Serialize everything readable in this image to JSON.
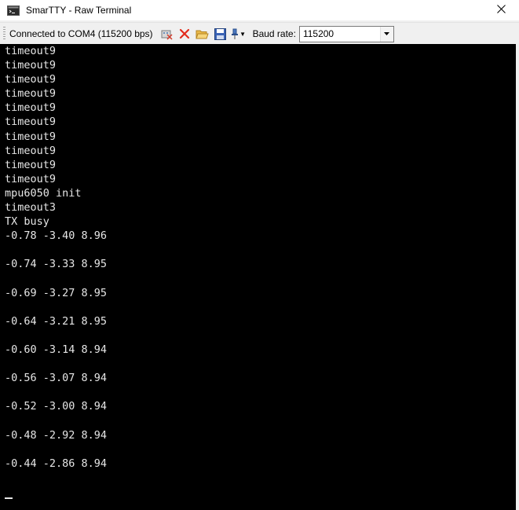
{
  "window": {
    "title": "SmarTTY - Raw Terminal"
  },
  "toolbar": {
    "connection_status": "Connected to COM4 (115200 bps)",
    "baud_label": "Baud rate:",
    "baud_value": "115200"
  },
  "terminal": {
    "lines": [
      "timeout9",
      "timeout9",
      "timeout9",
      "timeout9",
      "timeout9",
      "timeout9",
      "timeout9",
      "timeout9",
      "timeout9",
      "timeout9",
      "mpu6050 init",
      "timeout3",
      "TX busy",
      "-0.78 -3.40 8.96",
      "",
      "-0.74 -3.33 8.95",
      "",
      "-0.69 -3.27 8.95",
      "",
      "-0.64 -3.21 8.95",
      "",
      "-0.60 -3.14 8.94",
      "",
      "-0.56 -3.07 8.94",
      "",
      "-0.52 -3.00 8.94",
      "",
      "-0.48 -2.92 8.94",
      "",
      "-0.44 -2.86 8.94"
    ]
  },
  "colors": {
    "terminal_bg": "#000000",
    "terminal_fg": "#e6e6e6",
    "toolbar_bg": "#f0f0f0"
  },
  "icons": [
    "terminal-app-icon",
    "close-icon",
    "port-settings-icon",
    "disconnect-icon",
    "open-folder-icon",
    "save-icon",
    "pin-icon"
  ]
}
